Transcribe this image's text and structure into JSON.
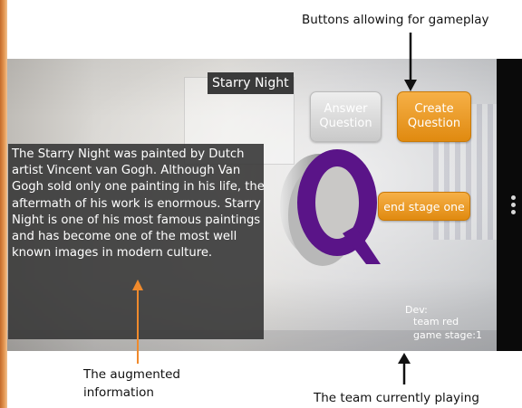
{
  "annotations": {
    "buttons_caption": "Buttons allowing for gameplay",
    "augmented_caption_line1": "The augmented",
    "augmented_caption_line2": "information",
    "team_caption": "The team currently playing"
  },
  "app": {
    "title_label": "Starry Night",
    "info_text": "The Starry Night was painted by Dutch artist Vincent van Gogh. Although Van Gogh sold only one painting in his life, the aftermath of his work is enormous. Starry Night is one of his most famous paintings and has become one of the most well known images in modern culture.",
    "buttons": {
      "answer_line1": "Answer",
      "answer_line2": "Question",
      "create_line1": "Create",
      "create_line2": "Question",
      "end_stage": "end stage one"
    },
    "dev_info": {
      "dev_label": "Dev:",
      "team_label": "team red",
      "stage_label": "game stage:1"
    },
    "overlay_glyph": "Q",
    "overflow_menu_icon": "vertical-ellipsis-icon"
  },
  "colors": {
    "accent_orange": "#e08a10",
    "q_purple": "#5a1488",
    "panel_dark": "#373737"
  }
}
